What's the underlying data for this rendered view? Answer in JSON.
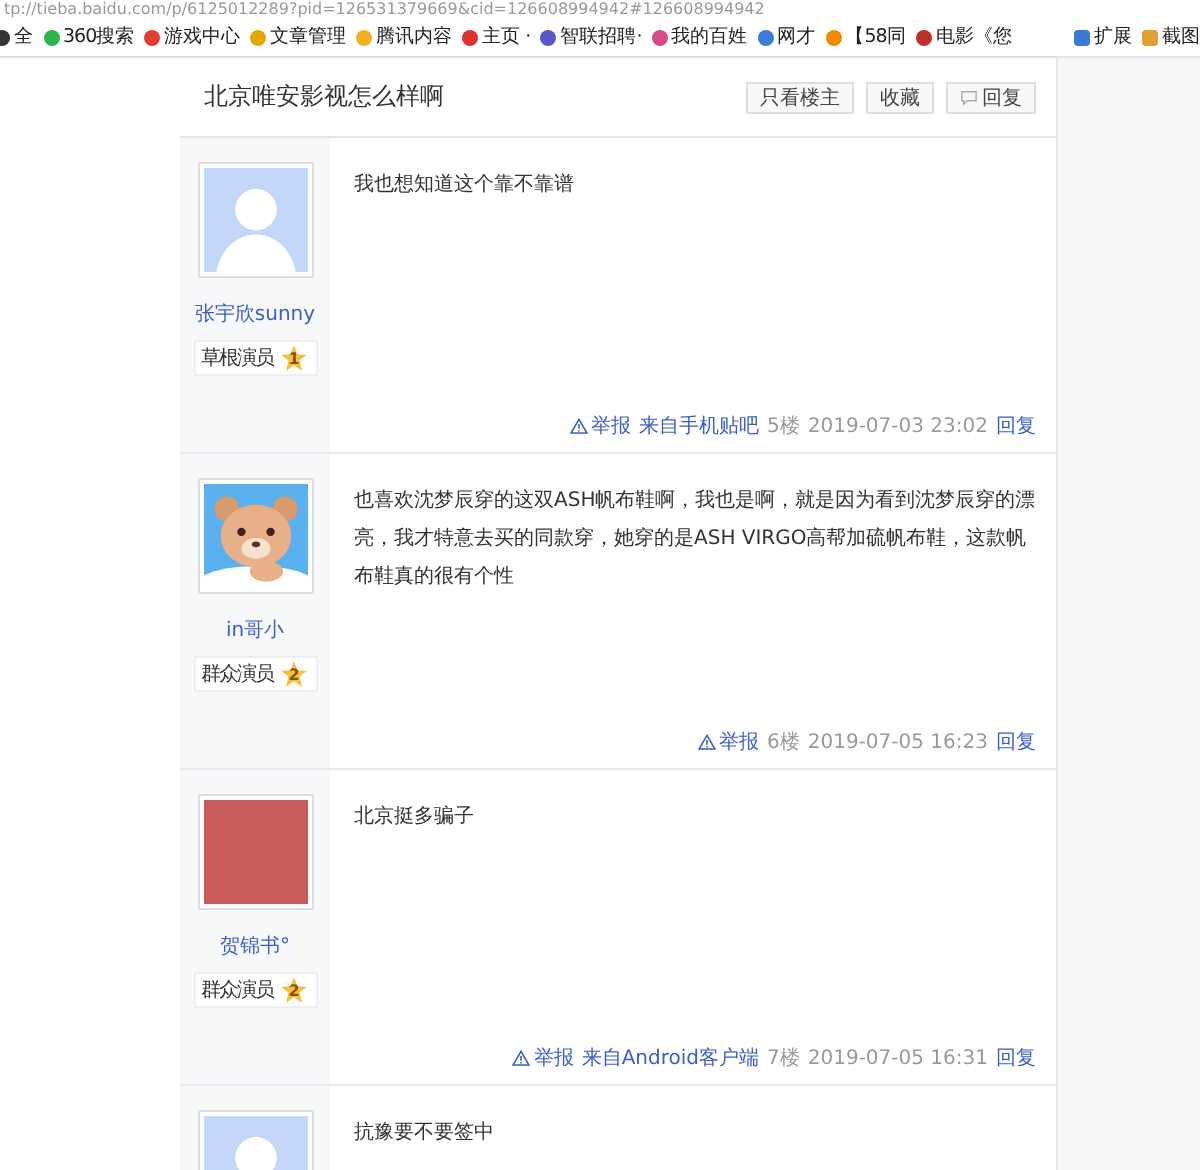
{
  "address_bar": {
    "url": "tp://tieba.baidu.com/p/6125012289?pid=126531379669&cid=126608994942#126608994942"
  },
  "bookmarks": [
    {
      "label": "全",
      "color": "#333333"
    },
    {
      "label": "360搜索",
      "color": "#2fb34a"
    },
    {
      "label": "游戏中心",
      "color": "#e23d2e"
    },
    {
      "label": "文章管理",
      "color": "#e0a800"
    },
    {
      "label": "腾讯内容",
      "color": "#f0b020"
    },
    {
      "label": "主页 ·",
      "color": "#e03030"
    },
    {
      "label": "智联招聘·",
      "color": "#5858c8"
    },
    {
      "label": "我的百姓",
      "color": "#d84a8a"
    },
    {
      "label": "网才",
      "color": "#3a7bd5"
    },
    {
      "label": "【58同",
      "color": "#f08a00"
    },
    {
      "label": "电影《您",
      "color": "#c0302a"
    }
  ],
  "bookmarks_right": [
    {
      "label": "扩展",
      "color": "#3a7bd5"
    },
    {
      "label": "截图",
      "color": "#e0a030"
    }
  ],
  "thread": {
    "title": "北京唯安影视怎么样啊",
    "buttons": [
      {
        "label": "只看楼主",
        "kind": "plain"
      },
      {
        "label": "收藏",
        "kind": "plain"
      },
      {
        "label": "回复",
        "kind": "reply"
      }
    ]
  },
  "posts": [
    {
      "username": "张宇欣sunny",
      "kind": "default",
      "rank": "草根演员",
      "level": "1",
      "content": "我也想知道这个靠不靠谱",
      "report": "举报",
      "source": "来自手机贴吧",
      "floor": "5楼",
      "time": "2019-07-03 23:02",
      "reply": "回复"
    },
    {
      "username": "in哥小",
      "kind": "bear",
      "rank": "群众演员",
      "level": "2",
      "content": "也喜欢沈梦辰穿的这双ASH帆布鞋啊，我也是啊，就是因为看到沈梦辰穿的漂亮，我才特意去买的同款穿，她穿的是ASH VIRGO高帮加硫帆布鞋，这款帆布鞋真的很有个性",
      "report": "举报",
      "floor": "6楼",
      "time": "2019-07-05 16:23",
      "reply": "回复"
    },
    {
      "username": "贺锦书°",
      "kind": "photo",
      "rank": "群众演员",
      "level": "2",
      "content": "北京挺多骗子",
      "report": "举报",
      "source": "来自Android客户端",
      "floor": "7楼",
      "time": "2019-07-05 16:31",
      "reply": "回复"
    },
    {
      "kind": "default",
      "content": "抗豫要不要签中"
    }
  ]
}
